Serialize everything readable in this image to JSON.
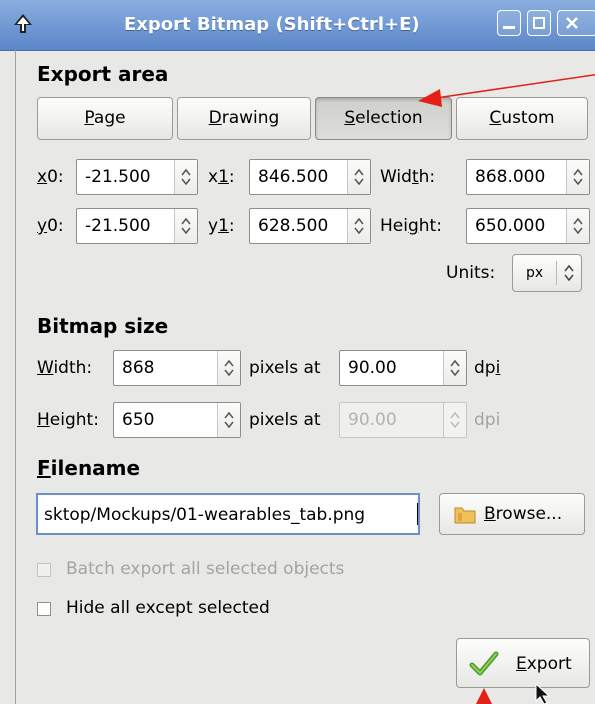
{
  "window": {
    "title": "Export Bitmap (Shift+Ctrl+E)"
  },
  "export_area": {
    "heading": "Export area",
    "buttons": [
      {
        "pre": "",
        "key": "P",
        "rest": "age"
      },
      {
        "pre": "",
        "key": "D",
        "rest": "rawing"
      },
      {
        "pre": "",
        "key": "S",
        "rest": "election"
      },
      {
        "pre": "",
        "key": "C",
        "rest": "ustom"
      }
    ],
    "active_button": "Selection",
    "x0_label_key": "x",
    "x0_label_rest": "0:",
    "x0": "-21.500",
    "x1_label_pre": "x",
    "x1_label_key": "1",
    "x1_label_rest": ":",
    "x1": "846.500",
    "width_label_pre": "Wid",
    "width_label_key": "t",
    "width_label_rest": "h:",
    "width": "868.000",
    "y0_label_key": "y",
    "y0_label_rest": "0:",
    "y0": "-21.500",
    "y1_label_pre": "y",
    "y1_label_key": "1",
    "y1_label_rest": ":",
    "y1": "628.500",
    "height_label_pre": "Hei",
    "height_label_key": "g",
    "height_label_rest": "ht:",
    "height": "650.000",
    "units_label": "Units:",
    "units_value": "px"
  },
  "bitmap_size": {
    "heading": "Bitmap size",
    "width_label_key": "W",
    "width_label_rest": "idth:",
    "width": "868",
    "pixels_at_1": "pixels at",
    "dpi_x": "90.00",
    "dpi_label_1_pre": "dp",
    "dpi_label_1_key": "i",
    "height_label_key": "H",
    "height_label_rest": "eight:",
    "height": "650",
    "pixels_at_2": "pixels at",
    "dpi_y": "90.00",
    "dpi_label_2": "dpi"
  },
  "filename": {
    "heading_key": "F",
    "heading_rest": "ilename",
    "value": "sktop/Mockups/01-wearables_tab.png",
    "browse_key": "B",
    "browse_rest": "rowse..."
  },
  "options": {
    "batch_export": "Batch export all selected objects",
    "hide_all": "Hide all except selected"
  },
  "export_button": {
    "key": "E",
    "rest": "xport"
  }
}
